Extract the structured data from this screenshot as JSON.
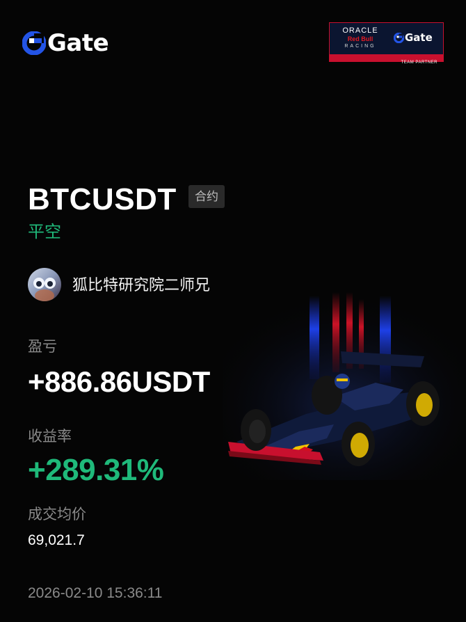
{
  "brand": {
    "name": "Gate",
    "accent": "#2354e6",
    "mark_color": "#ffffff"
  },
  "partner": {
    "oracle": "ORACLE",
    "redbull": "Red Bull",
    "racing": "RACING",
    "gate": "Gate",
    "strip": "TEAM PARTNER",
    "border_color": "#c8102e"
  },
  "trade": {
    "pair": "BTCUSDT",
    "type_badge": "合约",
    "side": "平空",
    "side_color": "#1fb97a"
  },
  "user": {
    "name": "狐比特研究院二师兄",
    "avatar_icon": "avatar-icon"
  },
  "pnl": {
    "label": "盈亏",
    "value": "+886.86USDT"
  },
  "roi": {
    "label": "收益率",
    "value": "+289.31%",
    "color": "#1fb97a"
  },
  "avg_price": {
    "label": "成交均价",
    "value": "69,021.7"
  },
  "timestamp": "2026-02-10 15:36:11",
  "artwork": {
    "icon": "race-car-icon",
    "livery": "#0f1a3a"
  }
}
